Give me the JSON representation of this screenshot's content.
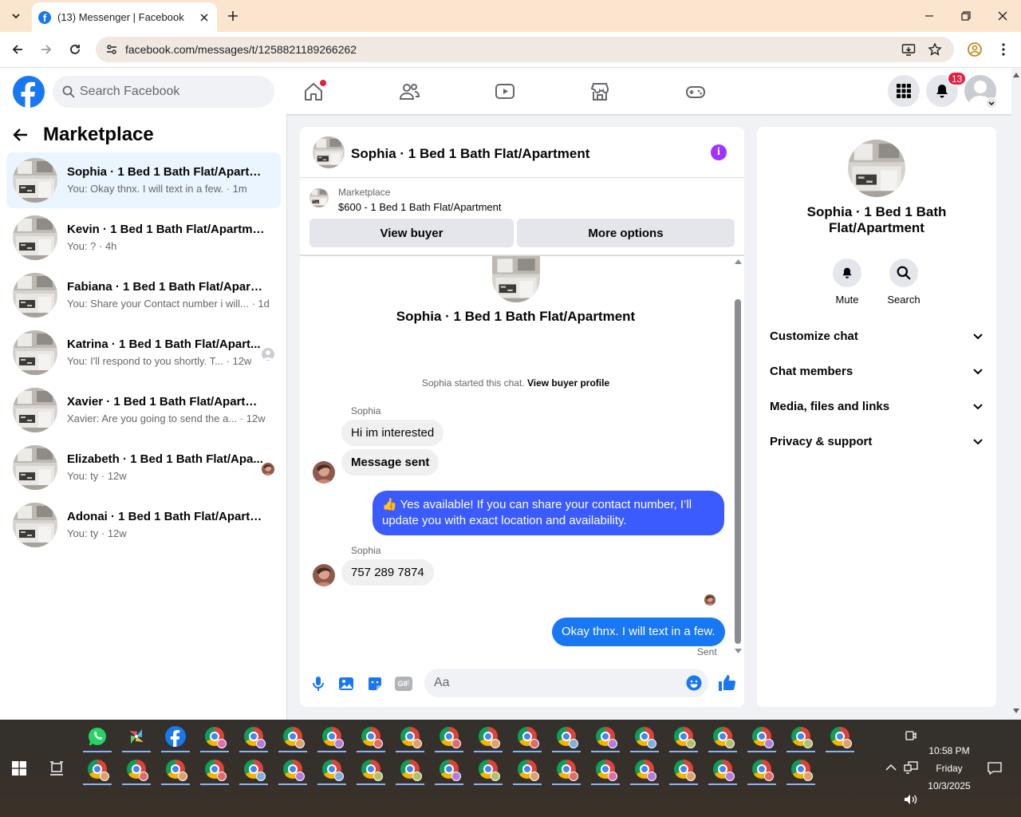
{
  "browser": {
    "tab_title": "(13) Messenger | Facebook",
    "url": "facebook.com/messages/t/1258821189266262"
  },
  "fb": {
    "search_placeholder": "Search Facebook",
    "notification_count": "13"
  },
  "left": {
    "title": "Marketplace",
    "conversations": [
      {
        "name": "Sophia · 1 Bed 1 Bath Flat/Apartme...",
        "preview": "You: Okay thnx. I will text in a few. · 1m"
      },
      {
        "name": "Kevin · 1 Bed 1 Bath Flat/Apartment",
        "preview": "You: ? · 4h"
      },
      {
        "name": "Fabiana · 1 Bed 1 Bath Flat/Apartm...",
        "preview": "You: Share your Contact number i will... · 1d"
      },
      {
        "name": "Katrina · 1 Bed 1 Bath Flat/Apart...",
        "preview": "You: I'll respond to you shortly. T... · 12w"
      },
      {
        "name": "Xavier · 1 Bed 1 Bath Flat/Apartment",
        "preview": "Xavier: Are you going to send the a... · 12w"
      },
      {
        "name": "Elizabeth · 1 Bed 1 Bath Flat/Apa...",
        "preview": "You: ty · 12w"
      },
      {
        "name": "Adonai · 1 Bed 1 Bath Flat/Apartm...",
        "preview": "You: ty · 12w"
      }
    ]
  },
  "chat": {
    "title": "Sophia · 1 Bed 1 Bath Flat/Apartment",
    "marketplace_label": "Marketplace",
    "listing": "$600 - 1 Bed 1 Bath Flat/Apartment",
    "view_buyer": "View buyer",
    "more_options": "More options",
    "started_text": "Sophia started this chat.",
    "view_buyer_profile": "View buyer profile",
    "sender": "Sophia",
    "messages": [
      {
        "text": "Hi im interested"
      },
      {
        "text": "Message sent"
      },
      {
        "text": "👍 Yes available! If you can share your contact number, I’ll update you with exact location and availability."
      },
      {
        "text": "757 289 7874"
      },
      {
        "text": "Okay thnx. I will text in a few."
      }
    ],
    "sent_status": "Sent",
    "composer_placeholder": "Aa",
    "gif_label": "GIF"
  },
  "info": {
    "name": "Sophia · 1 Bed 1 Bath Flat/Apartment",
    "mute": "Mute",
    "search": "Search",
    "sections": [
      "Customize chat",
      "Chat members",
      "Media, files and links",
      "Privacy & support"
    ]
  },
  "taskbar": {
    "time": "10:58 PM",
    "day": "Friday",
    "date": "10/3/2025"
  },
  "colors": {
    "accent": "#1877f2",
    "outgoing_bubble": "#3b5bff",
    "badge": "#e41e3f",
    "active_row": "#ebf5ff"
  }
}
